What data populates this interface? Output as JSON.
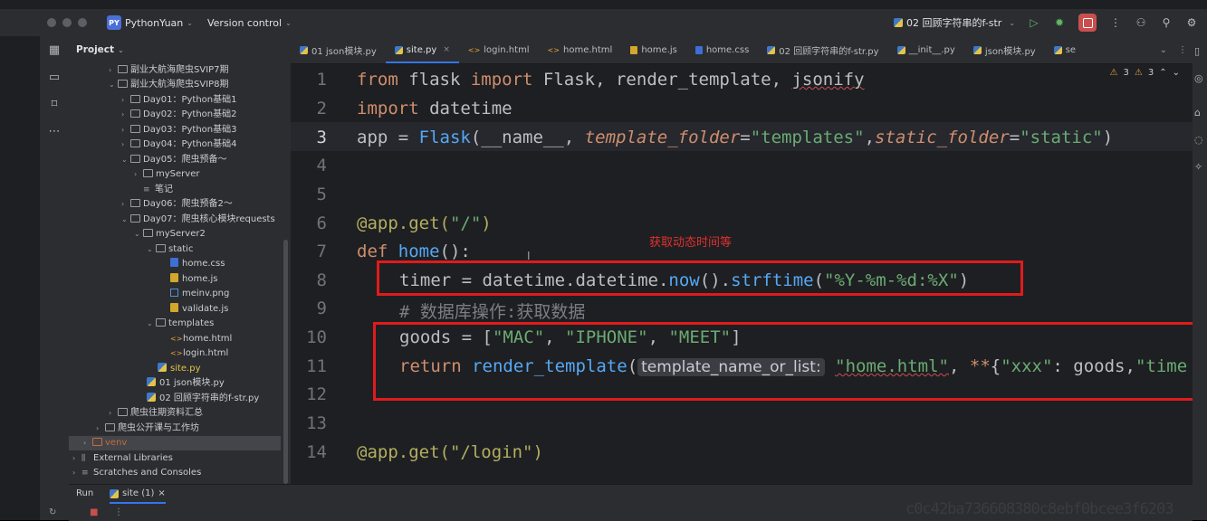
{
  "titlebar": {
    "project_badge": "PY",
    "project_name": "PythonYuan",
    "version_control": "Version control",
    "run_config": "02 回顾字符串的f-str",
    "icons": [
      "play-icon",
      "debug-icon",
      "stop-icon",
      "more-icon",
      "add-user-icon",
      "search-icon",
      "settings-icon"
    ]
  },
  "project_panel": {
    "title": "Project",
    "tree": [
      {
        "label": "副业大航海爬虫SVIP7期",
        "kind": "folder",
        "state": "collapsed"
      },
      {
        "label": "副业大航海爬虫SVIP8期",
        "kind": "folder",
        "state": "expanded"
      },
      {
        "label": "Day01：Python基础1",
        "kind": "folder",
        "state": "collapsed"
      },
      {
        "label": "Day02：Python基础2",
        "kind": "folder",
        "state": "collapsed"
      },
      {
        "label": "Day03：Python基础3",
        "kind": "folder",
        "state": "collapsed"
      },
      {
        "label": "Day04：Python基础4",
        "kind": "folder",
        "state": "collapsed"
      },
      {
        "label": "Day05：爬虫预备～",
        "kind": "folder",
        "state": "expanded"
      },
      {
        "label": "myServer",
        "kind": "folder",
        "state": "collapsed"
      },
      {
        "label": "笔记",
        "kind": "text"
      },
      {
        "label": "Day06：爬虫预备2～",
        "kind": "folder",
        "state": "collapsed"
      },
      {
        "label": "Day07：爬虫核心模块requests",
        "kind": "folder",
        "state": "expanded"
      },
      {
        "label": "myServer2",
        "kind": "folder",
        "state": "expanded"
      },
      {
        "label": "static",
        "kind": "folder",
        "state": "expanded"
      },
      {
        "label": "home.css",
        "kind": "css"
      },
      {
        "label": "home.js",
        "kind": "js"
      },
      {
        "label": "meinv.png",
        "kind": "png"
      },
      {
        "label": "validate.js",
        "kind": "js"
      },
      {
        "label": "templates",
        "kind": "folder",
        "state": "expanded"
      },
      {
        "label": "home.html",
        "kind": "html"
      },
      {
        "label": "login.html",
        "kind": "html"
      },
      {
        "label": "site.py",
        "kind": "py"
      },
      {
        "label": "01 json模块.py",
        "kind": "py"
      },
      {
        "label": "02 回顾字符串的f-str.py",
        "kind": "py"
      },
      {
        "label": "爬虫往期资料汇总",
        "kind": "folder",
        "state": "collapsed"
      },
      {
        "label": "爬虫公开课与工作坊",
        "kind": "folder",
        "state": "collapsed"
      },
      {
        "label": "venv",
        "kind": "folder",
        "state": "collapsed"
      },
      {
        "label": "External Libraries",
        "kind": "lib",
        "state": "collapsed"
      },
      {
        "label": "Scratches and Consoles",
        "kind": "lines",
        "state": "collapsed"
      }
    ]
  },
  "tabs": [
    {
      "label": "01 json模块.py",
      "kind": "py"
    },
    {
      "label": "site.py",
      "kind": "py",
      "active": true,
      "close": "×"
    },
    {
      "label": "login.html",
      "kind": "html"
    },
    {
      "label": "home.html",
      "kind": "html"
    },
    {
      "label": "home.js",
      "kind": "js"
    },
    {
      "label": "home.css",
      "kind": "css"
    },
    {
      "label": "02 回顾字符串的f-str.py",
      "kind": "py"
    },
    {
      "label": "__init__.py",
      "kind": "py"
    },
    {
      "label": "json模块.py",
      "kind": "py"
    },
    {
      "label": "se",
      "kind": "py"
    }
  ],
  "inspections": {
    "warnings_a": "3",
    "warnings_b": "3"
  },
  "editor": {
    "line_numbers": [
      "1",
      "2",
      "3",
      "4",
      "5",
      "6",
      "7",
      "8",
      "9",
      "10",
      "11",
      "12",
      "13",
      "14"
    ],
    "current_line": "3",
    "annotation": "获取动态时间等",
    "lines": {
      "l1": {
        "from": "from",
        "mod": " flask ",
        "import": "import",
        "names": " Flask, render_template, ",
        "jsonify": "jsonify"
      },
      "l2": {
        "import": "import",
        "mod": " datetime"
      },
      "l3": {
        "lhs": "app = ",
        "fn": "Flask",
        "open": "(__name__, ",
        "p1": "template_folder",
        "eq1": "=",
        "s1": "\"templates\"",
        "comma": ",",
        "p2": "static_folder",
        "eq2": "=",
        "s2": "\"static\"",
        "close": ")"
      },
      "l6": {
        "dec": "@app.get(",
        "s": "\"/\"",
        "close": ")"
      },
      "l7": {
        "def": "def",
        "sp": " ",
        "fn": "home",
        "rest": "():"
      },
      "l8": {
        "lhs": "timer = datetime.datetime.",
        "fn": "now",
        "mid": "().",
        "fn2": "strftime",
        "open": "(",
        "s": "\"%Y-%m-%d:%X\"",
        "close": ")"
      },
      "l9": {
        "comment": "# 数据库操作:获取数据"
      },
      "l10": {
        "lhs": "goods = [",
        "s1": "\"MAC\"",
        "c1": ", ",
        "s2": "\"IPHONE\"",
        "c2": ", ",
        "s3": "\"MEET\"",
        "close": "]"
      },
      "l11": {
        "ret": "return",
        "sp": " ",
        "fn": "render_template",
        "open": "(",
        "hint": "template_name_or_list:",
        "s1": "\"home.html\"",
        "c1": ", ",
        "star": "**",
        "brace": "{",
        "s2": "\"xxx\"",
        "colon": ": goods",
        "comma": ",",
        "s3": "\"time"
      },
      "l14": {
        "text": "@app.get(\"/login\")"
      }
    }
  },
  "bottom": {
    "run_label": "Run",
    "run_tab": "site (1)",
    "close": "×"
  },
  "watermark": "c0c42ba736608380c8ebf0bcee3f6203",
  "colors": {
    "accent": "#3574f0",
    "highlight_box": "#e01b1b",
    "annotation": "#e0302f"
  }
}
